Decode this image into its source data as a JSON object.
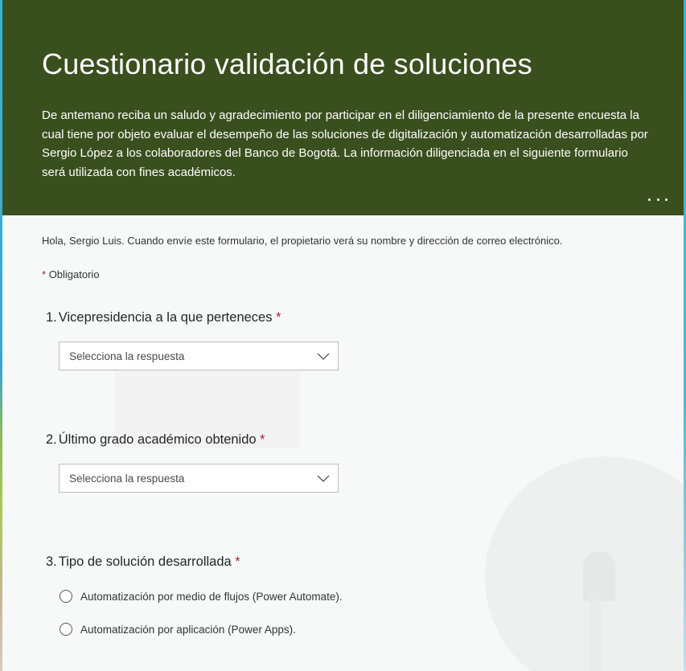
{
  "header": {
    "title": "Cuestionario validación de soluciones",
    "description": "De antemano reciba un saludo y agradecimiento por participar en el diligenciamiento de la presente encuesta la cual tiene por objeto evaluar el desempeño de las soluciones de digitalización y automatización desarrolladas por Sergio López a los colaboradores del Banco de Bogotá. La información diligenciada en el siguiente formulario será utilizada con fines académicos.",
    "background_color": "#3a4f1e",
    "more_icon": "ellipsis-icon"
  },
  "notice": "Hola, Sergio Luis. Cuando envíe este formulario, el propietario verá su nombre y dirección de correo electrónico.",
  "required_note": {
    "asterisk": "*",
    "label": "Obligatorio"
  },
  "questions": [
    {
      "number": "1.",
      "title": "Vicepresidencia a la que perteneces",
      "required_mark": "*",
      "type": "dropdown",
      "placeholder": "Selecciona la respuesta"
    },
    {
      "number": "2.",
      "title": "Último grado académico obtenido",
      "required_mark": "*",
      "type": "dropdown",
      "placeholder": "Selecciona la respuesta"
    },
    {
      "number": "3.",
      "title": "Tipo de solución desarrollada",
      "required_mark": "*",
      "type": "radio",
      "options": [
        "Automatización por medio de flujos (Power Automate).",
        "Automatización por aplicación (Power Apps)."
      ]
    }
  ],
  "colors": {
    "required": "#a4262c",
    "page_background": "#f7f9f8"
  }
}
